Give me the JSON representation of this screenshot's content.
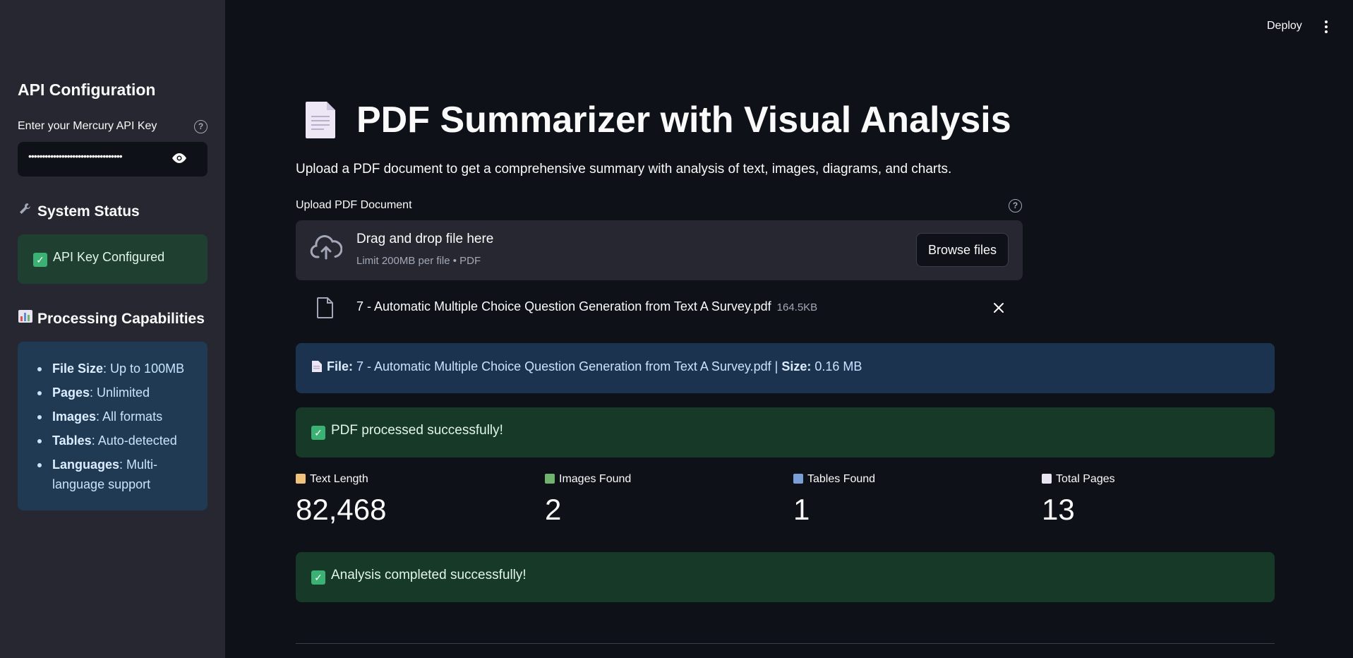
{
  "header": {
    "deploy_label": "Deploy",
    "menu_icon": "kebab-menu-icon"
  },
  "sidebar": {
    "title": "API Configuration",
    "api_key_label": "Enter your Mercury API Key",
    "api_key_value": "••••••••••••••••••••••••••••••••••",
    "system_status_title": "System Status",
    "system_status_icon": "wrench-icon",
    "api_status_text": "API Key Configured",
    "capabilities_title": "Processing Capabilities",
    "capabilities_icon": "bar-chart-icon",
    "capabilities": [
      {
        "key": "File Size",
        "value": ": Up to 100MB"
      },
      {
        "key": "Pages",
        "value": ": Unlimited"
      },
      {
        "key": "Images",
        "value": ": All formats"
      },
      {
        "key": "Tables",
        "value": ": Auto-detected"
      },
      {
        "key": "Languages",
        "value": ": Multi-language support"
      }
    ]
  },
  "main": {
    "title": "PDF Summarizer with Visual Analysis",
    "subtitle": "Upload a PDF document to get a comprehensive summary with analysis of text, images, diagrams, and charts.",
    "uploader": {
      "label": "Upload PDF Document",
      "drop_title": "Drag and drop file here",
      "drop_sub": "Limit 200MB per file • PDF",
      "browse_label": "Browse files"
    },
    "uploaded_file": {
      "name": "7 - Automatic Multiple Choice Question Generation from Text A Survey.pdf",
      "size": "164.5KB"
    },
    "file_info": {
      "file_label": "File:",
      "file_value": " 7 - Automatic Multiple Choice Question Generation from Text A Survey.pdf | ",
      "size_label": "Size:",
      "size_value": " 0.16 MB"
    },
    "processed_message": "PDF processed successfully!",
    "metrics": [
      {
        "label": "Text Length",
        "value": "82,468",
        "icon": "memo-icon",
        "color": "#f0c27b"
      },
      {
        "label": "Images Found",
        "value": "2",
        "icon": "picture-icon",
        "color": "#6fb36f"
      },
      {
        "label": "Tables Found",
        "value": "1",
        "icon": "bar-chart-icon",
        "color": "#7a9fd6"
      },
      {
        "label": "Total Pages",
        "value": "13",
        "icon": "page-icon",
        "color": "#e8e4f2"
      }
    ],
    "analysis_message": "Analysis completed successfully!"
  },
  "colors": {
    "background": "#0e1117",
    "sidebar": "#262730",
    "success_bg": "#173928",
    "info_bg": "#1c3350",
    "success_check": "#3bb273"
  }
}
